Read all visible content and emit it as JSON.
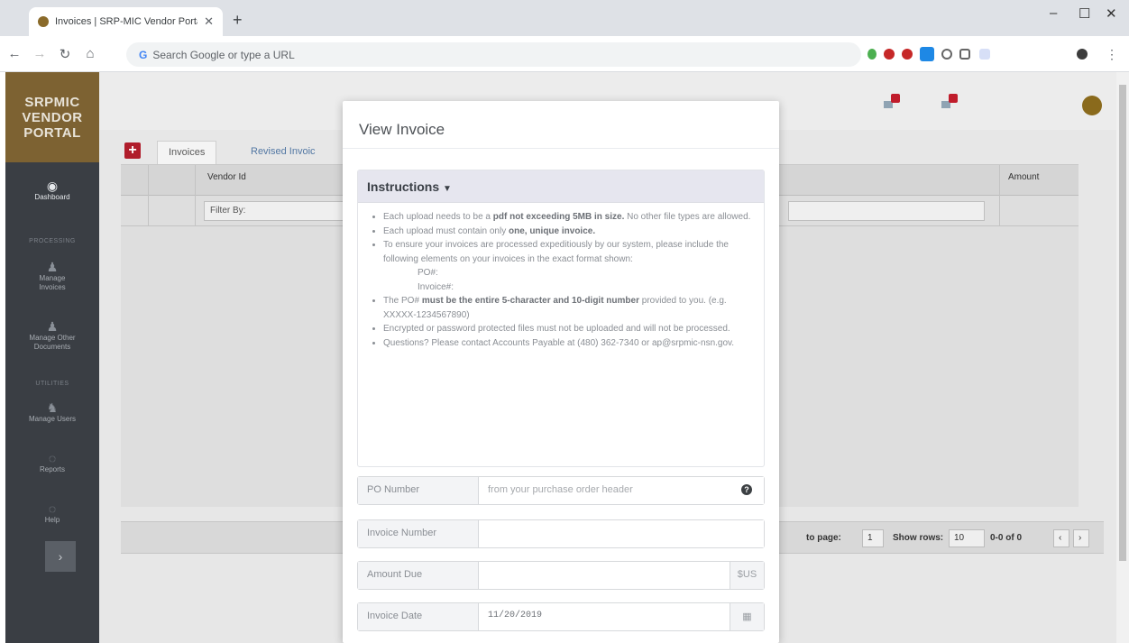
{
  "browser": {
    "tab_title": "Invoices | SRP-MIC Vendor Portal",
    "tab_close": "✕",
    "new_tab": "+",
    "omnibox_placeholder": "Search Google or type a URL",
    "window_min": "–",
    "window_max": "☐",
    "window_close": "✕"
  },
  "sidebar": {
    "logo_lines": [
      "SRPMIC",
      "VENDOR",
      "PORTAL"
    ],
    "items": [
      {
        "label": "Dashboard",
        "icon": "dashboard-icon",
        "glyph": "◉"
      },
      {
        "label": "Manage Invoices",
        "icon": "user-icon",
        "glyph": "♟"
      },
      {
        "label": "Manage Other Documents",
        "icon": "user-icon",
        "glyph": "♟"
      },
      {
        "label": "Manage Users",
        "icon": "users-icon",
        "glyph": "♞"
      },
      {
        "label": "Reports",
        "icon": "reports-icon",
        "glyph": "◌"
      },
      {
        "label": "Help",
        "icon": "help-icon",
        "glyph": "◌"
      }
    ],
    "sections": [
      "PROCESSING",
      "UTILITIES"
    ],
    "expand_glyph": "›"
  },
  "main": {
    "tabs": [
      "Invoices",
      "Revised Invoic"
    ],
    "add_glyph": "+",
    "columns": [
      "Vendor Id",
      "Amount"
    ],
    "filter_placeholder": "Filter By:",
    "pager": {
      "goto_label": "to page:",
      "page_value": "1",
      "rows_label": "Show rows:",
      "rows_value": "10",
      "range": "0-0 of 0"
    }
  },
  "modal": {
    "title": "View Invoice",
    "instructions_title": "Instructions",
    "instructions": {
      "b1_pre": "Each upload needs to be a ",
      "b1_bold": "pdf not exceeding 5MB in size.",
      "b1_post": " No other file types are allowed.",
      "b2_pre": "Each upload must contain only ",
      "b2_bold": "one, unique invoice.",
      "b3": "To ensure your invoices are processed expeditiously by our system, please include the following elements on your invoices in the exact format shown:",
      "b3_sub1": "PO#:",
      "b3_sub2": "Invoice#:",
      "b4_pre": "The PO# ",
      "b4_bold": "must be the entire 5-character and 10-digit number",
      "b4_post": " provided to you. (e.g. XXXXX-1234567890)",
      "b5": "Encrypted or password protected files must not be uploaded and will not be processed.",
      "b6": "Questions? Please contact Accounts Payable at (480) 362-7340 or ap@srpmic-nsn.gov."
    },
    "fields": {
      "po_label": "PO Number",
      "po_placeholder": "from your purchase order header",
      "invoice_label": "Invoice Number",
      "invoice_value": "",
      "amount_label": "Amount Due",
      "amount_value": "",
      "amount_addon": "$US",
      "date_label": "Invoice Date",
      "date_value": "11/20/2019"
    }
  },
  "colors": {
    "sidebar_bg": "#3a3e44",
    "logo_bg": "#7d6232",
    "accent_red": "#b01d2b"
  }
}
